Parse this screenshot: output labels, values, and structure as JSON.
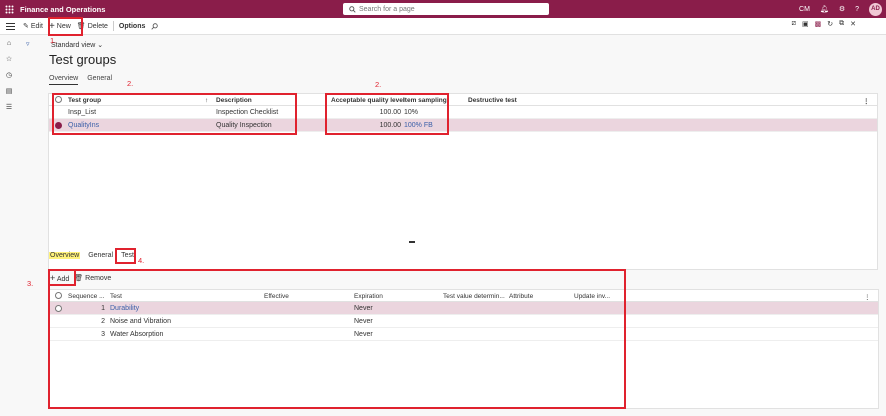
{
  "app": {
    "title": "Finance and Operations",
    "search_placeholder": "Search for a page",
    "company": "CM",
    "avatar": "AD"
  },
  "toolbar": {
    "edit": "Edit",
    "new": "New",
    "delete": "Delete",
    "options": "Options"
  },
  "page": {
    "view": "Standard view",
    "title": "Test groups",
    "tabs": [
      "Overview",
      "General"
    ]
  },
  "grid1": {
    "headers": [
      "Test group",
      "Description",
      "Acceptable quality level",
      "Item sampling",
      "Destructive test"
    ],
    "rows": [
      {
        "group": "Insp_List",
        "desc": "Inspection Checklist",
        "aql": "100.00",
        "sampling": "10%"
      },
      {
        "group": "QualityIns",
        "desc": "Quality Inspection",
        "aql": "100.00",
        "sampling": "100% FB"
      }
    ]
  },
  "lower": {
    "tabs": [
      "Overview",
      "General",
      "Test"
    ],
    "add": "Add",
    "remove": "Remove",
    "headers": [
      "Sequence ...",
      "Test",
      "Effective",
      "Expiration",
      "Test value determin...",
      "Attribute",
      "Update inv..."
    ],
    "rows": [
      {
        "seq": "1",
        "test": "Durability",
        "exp": "Never"
      },
      {
        "seq": "2",
        "test": "Noise and Vibration",
        "exp": "Never"
      },
      {
        "seq": "3",
        "test": "Water Absorption",
        "exp": "Never"
      }
    ]
  },
  "annotations": [
    "1.",
    "2.",
    "2.",
    "3.",
    "4."
  ],
  "colors": {
    "brand": "#8a1d4a",
    "highlight": "#e0222e",
    "selected_row": "#ebd5de"
  }
}
